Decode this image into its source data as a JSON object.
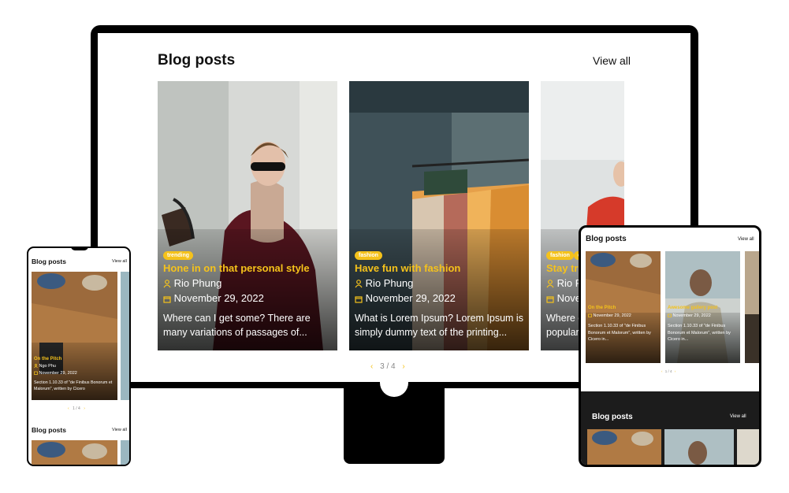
{
  "section": {
    "title": "Blog posts",
    "view_all": "View all"
  },
  "desktop": {
    "cards": [
      {
        "tag": "trending",
        "title": "Hone in on that personal style",
        "author": "Rio Phung",
        "date": "November 29, 2022",
        "excerpt": "Where can I get some? There are many variations of passages of..."
      },
      {
        "tag": "fashion",
        "title": "Have fun with fashion",
        "author": "Rio Phung",
        "date": "November 29, 2022",
        "excerpt": "What is Lorem Ipsum? Lorem Ipsum is simply dummy text of the printing..."
      },
      {
        "tag": "fashion",
        "tag2": "ca",
        "title": "Stay tr",
        "author": "Rio Phung",
        "date": "Nove",
        "excerpt": "Where c... popular"
      }
    ],
    "pager": "3 / 4"
  },
  "phone": {
    "card": {
      "title": "On the Pitch",
      "author": "Ngo Phu",
      "date": "November 29, 2022",
      "excerpt": "Section 1.10.33 of \"de Finibus Bonorum et Malorum\", written by Cicero"
    },
    "pager": "1 / 4"
  },
  "tablet": {
    "cards": [
      {
        "title": "On the Pitch",
        "date": "November 29, 2022",
        "excerpt": "Section 1.10.33 of \"de Finibus Bonorum et Malorum\", written by Cicero in..."
      },
      {
        "title": "Awesome gallery post",
        "date": "November 29, 2022",
        "excerpt": "Section 1.10.33 of \"de Finibus Bonorum et Malorum\", written by Cicero in..."
      }
    ],
    "pager": "1 / 4"
  },
  "colors": {
    "accent": "#f5c21b",
    "frame": "#000000",
    "dark_section": "#1c1c1c"
  },
  "icons": [
    "user-icon",
    "calendar-icon",
    "chevron-left-icon",
    "chevron-right-icon"
  ]
}
